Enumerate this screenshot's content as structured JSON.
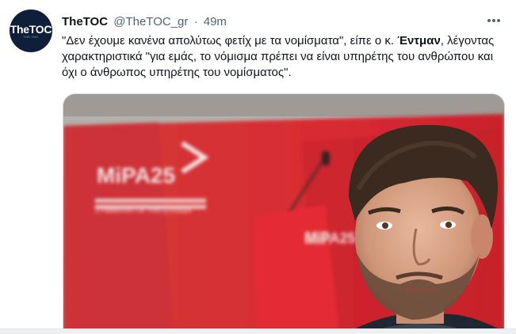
{
  "author": {
    "name": "TheTOC",
    "handle": "@TheTOC_gr",
    "separator": "·",
    "time": "49m"
  },
  "avatar": {
    "logo_text": "TheTOC",
    "logo_subtext": "THE TOC"
  },
  "tweet": {
    "text_before": "\"Δεν έχουμε κανένα απολύτως φετίχ με τα νομίσματα\", είπε ο κ. ",
    "text_bold": "Έντμαν",
    "text_after": ", λέγοντας χαρακτηριστικά \"για εμάς, το νόμισμα πρέπει να είναι υπηρέτης του ανθρώπου και όχι ο άνθρωπος υπηρέτης του νομίσματος\"."
  },
  "card": {
    "image_sign_text": "MiPA25",
    "image_subtext": "ΣΥΜΜΑΧΙΑ ΓΙΑ ΤΗΝ ΕΛΛΑΔΑ",
    "image_podium_text": "MiPA25"
  },
  "colors": {
    "brand_red": "#d8242f",
    "text_primary": "#0f1419",
    "text_secondary": "#536471",
    "border": "#cfd9de"
  },
  "icons": {
    "more": "more-horizontal-icon"
  }
}
